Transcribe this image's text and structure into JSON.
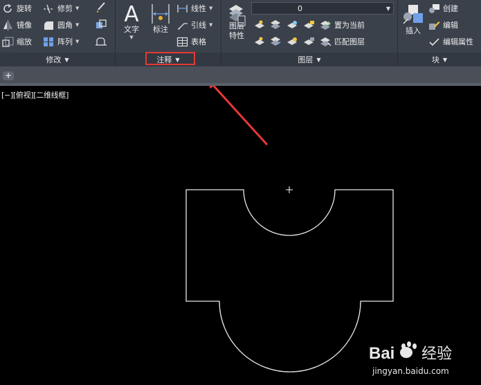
{
  "panels": {
    "modify": {
      "title": "修改",
      "items": [
        "旋转",
        "镜像",
        "缩放",
        "修剪",
        "圆角",
        "阵列"
      ]
    },
    "annotation": {
      "title": "注释",
      "text_label": "文字",
      "dim_label": "标注",
      "items": [
        "线性",
        "引线",
        "表格"
      ]
    },
    "layers": {
      "title": "图层",
      "props_label_1": "图层",
      "props_label_2": "特性",
      "current_layer": "0",
      "set_current": "置为当前",
      "match_layer": "匹配图层"
    },
    "block": {
      "title": "块",
      "insert": "插入",
      "create": "创建",
      "edit": "编辑",
      "edit_attr": "编辑属性"
    }
  },
  "viewport": {
    "label": "[−][俯视][二维线框]"
  },
  "watermark": {
    "brand_bai": "Bai",
    "brand_du": "du",
    "brand_cn": "经验",
    "url": "jingyan.baidu.com"
  },
  "colors": {
    "ribbon": "#3b414b",
    "canvas": "#000000",
    "highlight": "#e53935",
    "arrow": "#e53935"
  }
}
